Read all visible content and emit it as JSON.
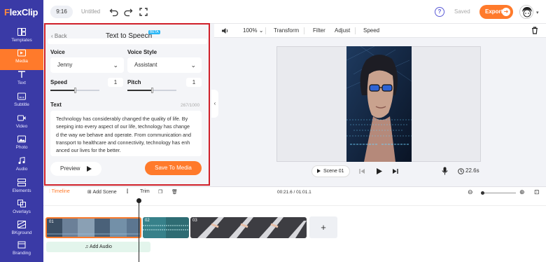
{
  "app": {
    "logo_first": "F",
    "logo_rest": "lexClip"
  },
  "sidebar": {
    "items": [
      {
        "label": "Templates",
        "icon": "templates-icon"
      },
      {
        "label": "Media",
        "icon": "media-icon",
        "active": true
      },
      {
        "label": "Text",
        "icon": "text-icon"
      },
      {
        "label": "Subtitle",
        "icon": "subtitle-icon"
      },
      {
        "label": "Video",
        "icon": "video-icon"
      },
      {
        "label": "Photo",
        "icon": "photo-icon"
      },
      {
        "label": "Audio",
        "icon": "audio-icon"
      },
      {
        "label": "Elements",
        "icon": "elements-icon"
      },
      {
        "label": "Overlays",
        "icon": "overlays-icon"
      },
      {
        "label": "BKground",
        "icon": "background-icon"
      },
      {
        "label": "Branding",
        "icon": "branding-icon"
      }
    ]
  },
  "topbar": {
    "ratio": "9:16",
    "title": "Untitled",
    "saved": "Saved",
    "export": "Export"
  },
  "panel": {
    "back": "Back",
    "title": "Text to Speech",
    "beta": "BETA",
    "voice_label": "Voice",
    "voice_value": "Jenny",
    "style_label": "Voice Style",
    "style_value": "Assistant",
    "speed_label": "Speed",
    "speed_value": "1",
    "speed_level": 0.5,
    "pitch_label": "Pitch",
    "pitch_value": "1",
    "pitch_level": 0.5,
    "text_label": "Text",
    "char_count": "267/1000",
    "text_lines": [
      "Technology has considerably changed the quality of life. By",
      "seeping into every aspect of our life, technology has change",
      "d the way we behave and operate. From communication and",
      "transport to healthcare and connectivity, technology has enh",
      "anced our lives for the better."
    ],
    "preview": "Preview",
    "save": "Save To Media"
  },
  "toolbar": {
    "zoom": "100%",
    "transform": "Transform",
    "filter": "Filter",
    "adjust": "Adjust",
    "speed": "Speed"
  },
  "player": {
    "scene": "Scene 01",
    "duration": "22.6s"
  },
  "timeline": {
    "timeline": "Timeline",
    "add_scene": "Add Scene",
    "trim": "Trim",
    "time": "00:21.6 / 01:01.1",
    "clips": [
      "01",
      "02",
      "03"
    ],
    "add_audio": "Add Audio",
    "add_clip": "+"
  },
  "colors": {
    "sidebar": "#3a3aa6",
    "accent": "#ff7a2b",
    "highlight": "#d0202a"
  }
}
